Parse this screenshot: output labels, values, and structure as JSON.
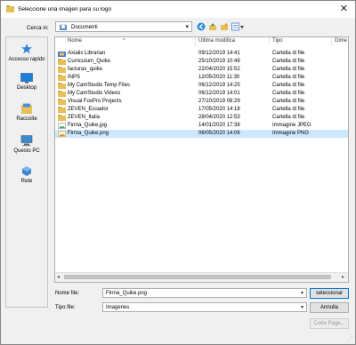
{
  "window": {
    "title": "Seleccione una imagen para su logo",
    "close_label": "✕"
  },
  "lookin": {
    "label": "Cerca in:",
    "value": "Documenti"
  },
  "places": [
    {
      "label": "Accesso rapido"
    },
    {
      "label": "Desktop"
    },
    {
      "label": "Raccolte"
    },
    {
      "label": "Questo PC"
    },
    {
      "label": "Rete"
    }
  ],
  "columns": {
    "name": "Nome",
    "modified": "Ultima modifica",
    "type": "Tipo",
    "dimension": "Dime"
  },
  "files": [
    {
      "name": "Axialis Librarian",
      "date": "09/12/2019 14:41",
      "type": "Cartella di file",
      "icon": "special-folder",
      "selected": false
    },
    {
      "name": "Curriculum_Quike",
      "date": "25/10/2019 10:48",
      "type": "Cartella di file",
      "icon": "folder",
      "selected": false
    },
    {
      "name": "facturas_quike",
      "date": "22/04/2020 15:52",
      "type": "Cartella di file",
      "icon": "folder",
      "selected": false
    },
    {
      "name": "INPS",
      "date": "12/05/2020 11:30",
      "type": "Cartella di file",
      "icon": "folder",
      "selected": false
    },
    {
      "name": "My CamStudio Temp Files",
      "date": "06/12/2019 14:25",
      "type": "Cartella di file",
      "icon": "folder",
      "selected": false
    },
    {
      "name": "My CamStudio Videos",
      "date": "06/12/2019 14:01",
      "type": "Cartella di file",
      "icon": "folder",
      "selected": false
    },
    {
      "name": "Visual FoxPro Projects",
      "date": "27/10/2019 08:29",
      "type": "Cartella di file",
      "icon": "folder",
      "selected": false
    },
    {
      "name": "ZEVEN_Ecuador",
      "date": "17/05/2020 14:18",
      "type": "Cartella di file",
      "icon": "folder",
      "selected": false
    },
    {
      "name": "ZEVEN_Italia",
      "date": "28/04/2020 12:53",
      "type": "Cartella di file",
      "icon": "folder",
      "selected": false
    },
    {
      "name": "Firma_Quike.jpg",
      "date": "14/01/2020 17:38",
      "type": "Immagine JPEG",
      "icon": "jpeg-image",
      "selected": false
    },
    {
      "name": "Firma_Quike.png",
      "date": "06/05/2020 14:06",
      "type": "Immagine PNG",
      "icon": "png-image",
      "selected": true
    }
  ],
  "form": {
    "filename_label": "Nome file:",
    "filename_value": "Firma_Quike.png",
    "filetype_label": "Tipo file:",
    "filetype_value": "Imagenes"
  },
  "buttons": {
    "select": "seleccionar",
    "cancel": "Annulla",
    "codepage": "Code Page..."
  },
  "colors": {
    "selection": "#cce8ff",
    "folder": "#e8c05a",
    "accent": "#0078d7"
  }
}
